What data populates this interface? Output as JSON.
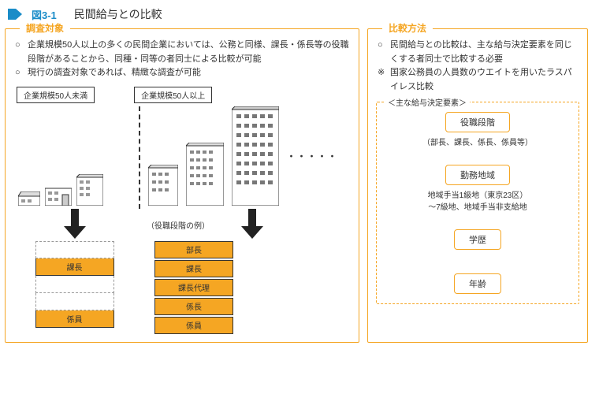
{
  "header": {
    "fig_num": "図3-1",
    "title": "民間給与との比較"
  },
  "left": {
    "label": "調査対象",
    "bullet1": "企業規模50人以上の多くの民間企業においては、公務と同様、課長・係長等の役職段階があることから、同種・同等の者同士による比較が可能",
    "bullet2": "現行の調査対象であれば、精緻な調査が可能",
    "scale_small": "企業規模50人未満",
    "scale_large": "企業規模50人以上",
    "dots": "・・・・・",
    "example": "（役職段階の例）",
    "ladder_small": [
      "",
      "課長",
      "",
      "",
      "係員"
    ],
    "ladder_large": [
      "部長",
      "課長",
      "課長代理",
      "係長",
      "係員"
    ]
  },
  "right": {
    "label": "比較方法",
    "bullet1": "民間給与との比較は、主な給与決定要素を同じくする者同士で比較する必要",
    "bullet2": "国家公務員の人員数のウエイトを用いたラスパイレス比較",
    "sub_label": "＜主な給与決定要素＞",
    "factors": {
      "f1": "役職段階",
      "f1_note": "（部長、課長、係長、係員等）",
      "f2": "勤務地域",
      "f2_note": "地域手当1級地（東京23区）\n～7級地、地域手当非支給地",
      "f3": "学歴",
      "f4": "年齢"
    }
  }
}
